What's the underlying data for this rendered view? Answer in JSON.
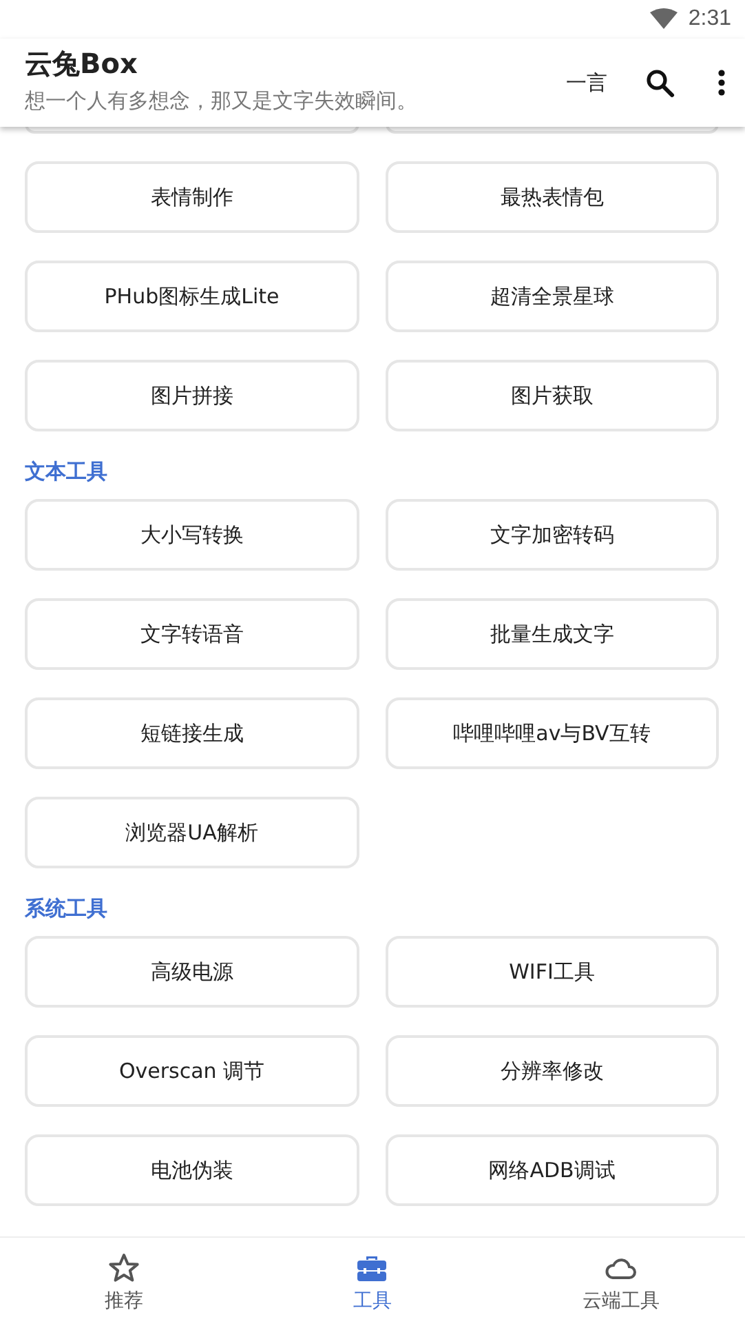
{
  "status_bar": {
    "time": "2:31"
  },
  "app_bar": {
    "title": "云兔Box",
    "subtitle": "想一个人有多想念，那又是文字失效瞬间。",
    "action": "一言"
  },
  "sections": [
    {
      "items": [
        "表情制作",
        "最热表情包",
        "PHub图标生成Lite",
        "超清全景星球",
        "图片拼接",
        "图片获取"
      ]
    },
    {
      "title": "文本工具",
      "items": [
        "大小写转换",
        "文字加密转码",
        "文字转语音",
        "批量生成文字",
        "短链接生成",
        "哔哩哔哩av与BV互转",
        "浏览器UA解析"
      ]
    },
    {
      "title": "系统工具",
      "items": [
        "高级电源",
        "WIFI工具",
        "Overscan 调节",
        "分辨率修改",
        "电池伪装",
        "网络ADB调试"
      ]
    }
  ],
  "bottom_nav": [
    {
      "label": "推荐",
      "kind": "star",
      "selected": false
    },
    {
      "label": "工具",
      "kind": "toolbox",
      "selected": true
    },
    {
      "label": "云端工具",
      "kind": "cloud",
      "selected": false
    }
  ]
}
